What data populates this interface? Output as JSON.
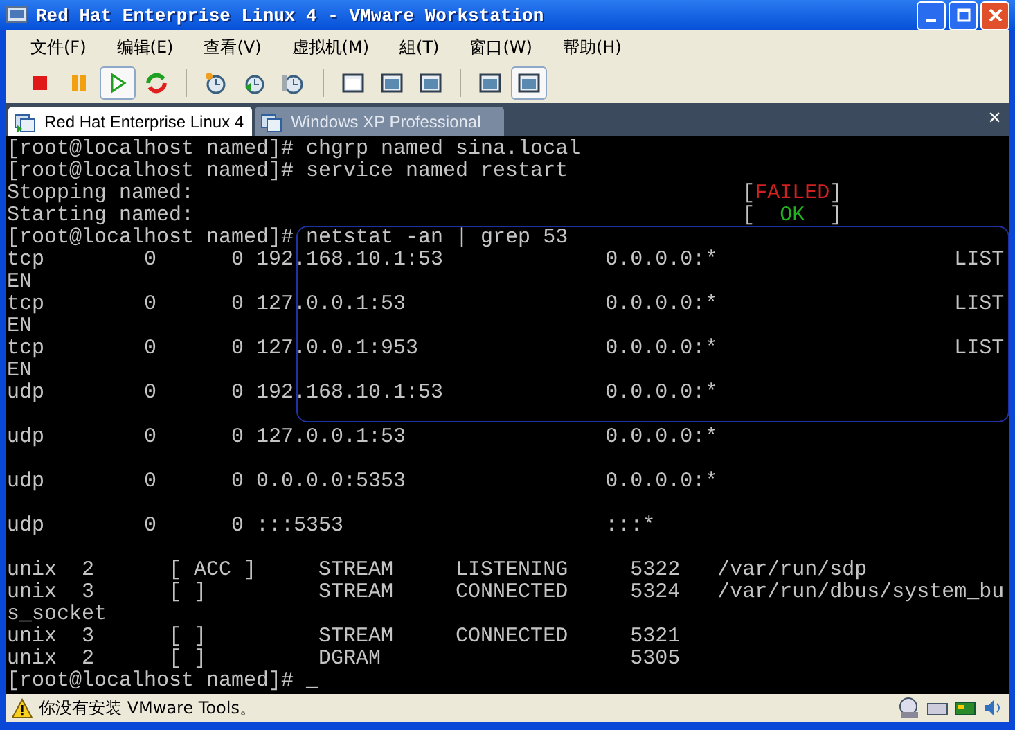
{
  "window": {
    "title": "Red Hat Enterprise Linux 4 - VMware Workstation"
  },
  "menu": [
    "文件(F)",
    "编辑(E)",
    "查看(V)",
    "虚拟机(M)",
    "組(T)",
    "窗口(W)",
    "帮助(H)"
  ],
  "toolbar": [
    [
      {
        "kind": "stop",
        "pressed": false
      },
      {
        "kind": "pause",
        "pressed": false
      },
      {
        "kind": "play",
        "pressed": true
      },
      {
        "kind": "reset",
        "pressed": false
      }
    ],
    [
      {
        "kind": "snapshot",
        "pressed": false
      },
      {
        "kind": "revert",
        "pressed": false
      },
      {
        "kind": "manager",
        "pressed": false
      }
    ],
    [
      {
        "kind": "console",
        "pressed": false
      },
      {
        "kind": "fullscreen",
        "pressed": false
      },
      {
        "kind": "quickswitch",
        "pressed": false
      }
    ],
    [
      {
        "kind": "summary",
        "pressed": false
      },
      {
        "kind": "appliance",
        "pressed": true
      }
    ]
  ],
  "tabs": [
    {
      "label": "Red Hat Enterprise Linux 4",
      "selected": true
    },
    {
      "label": "Windows XP Professional",
      "selected": false
    }
  ],
  "tab_close": "×",
  "terminal": {
    "lines": [
      {
        "segments": [
          {
            "kind": "plain",
            "text": "[root@localhost named]# chgrp named sina.local"
          }
        ]
      },
      {
        "segments": [
          {
            "kind": "plain",
            "text": "[root@localhost named]# service named restart"
          }
        ]
      },
      {
        "segments": [
          {
            "kind": "plain",
            "text": "Stopping named:                                            ["
          },
          {
            "kind": "failed",
            "text": "FAILED"
          },
          {
            "kind": "plain",
            "text": "]"
          }
        ]
      },
      {
        "segments": [
          {
            "kind": "plain",
            "text": "Starting named:                                            [  "
          },
          {
            "kind": "ok",
            "text": "OK"
          },
          {
            "kind": "plain",
            "text": "  ]"
          }
        ]
      },
      {
        "segments": [
          {
            "kind": "plain",
            "text": "[root@localhost named]# netstat -an | grep 53"
          }
        ]
      },
      {
        "segments": [
          {
            "kind": "plain",
            "text": "tcp        0      0 192.168.10.1:53             0.0.0.0:*                   LIST"
          }
        ]
      },
      {
        "segments": [
          {
            "kind": "plain",
            "text": "EN"
          }
        ]
      },
      {
        "segments": [
          {
            "kind": "plain",
            "text": "tcp        0      0 127.0.0.1:53                0.0.0.0:*                   LIST"
          }
        ]
      },
      {
        "segments": [
          {
            "kind": "plain",
            "text": "EN"
          }
        ]
      },
      {
        "segments": [
          {
            "kind": "plain",
            "text": "tcp        0      0 127.0.0.1:953               0.0.0.0:*                   LIST"
          }
        ]
      },
      {
        "segments": [
          {
            "kind": "plain",
            "text": "EN"
          }
        ]
      },
      {
        "segments": [
          {
            "kind": "plain",
            "text": "udp        0      0 192.168.10.1:53             0.0.0.0:*"
          }
        ],
        "continuation_row": true
      },
      {
        "segments": [
          {
            "kind": "plain",
            "text": "udp        0      0 127.0.0.1:53                0.0.0.0:*"
          }
        ],
        "continuation_row": true
      },
      {
        "segments": [
          {
            "kind": "plain",
            "text": "udp        0      0 0.0.0.0:5353                0.0.0.0:*"
          }
        ],
        "continuation_row": true
      },
      {
        "segments": [
          {
            "kind": "plain",
            "text": "udp        0      0 :::5353                     :::*"
          }
        ],
        "continuation_row": true
      },
      {
        "segments": [
          {
            "kind": "plain",
            "text": "unix  2      [ ACC ]     STREAM     LISTENING     5322   /var/run/sdp"
          }
        ]
      },
      {
        "segments": [
          {
            "kind": "plain",
            "text": "unix  3      [ ]         STREAM     CONNECTED     5324   /var/run/dbus/system_bu"
          }
        ]
      },
      {
        "segments": [
          {
            "kind": "plain",
            "text": "s_socket"
          }
        ]
      },
      {
        "segments": [
          {
            "kind": "plain",
            "text": "unix  3      [ ]         STREAM     CONNECTED     5321"
          }
        ]
      },
      {
        "segments": [
          {
            "kind": "plain",
            "text": "unix  2      [ ]         DGRAM                    5305"
          }
        ]
      },
      {
        "segments": [
          {
            "kind": "plain",
            "text": "[root@localhost named]# _"
          }
        ]
      }
    ]
  },
  "status_bar": {
    "message": "你没有安装 VMware Tools。"
  }
}
